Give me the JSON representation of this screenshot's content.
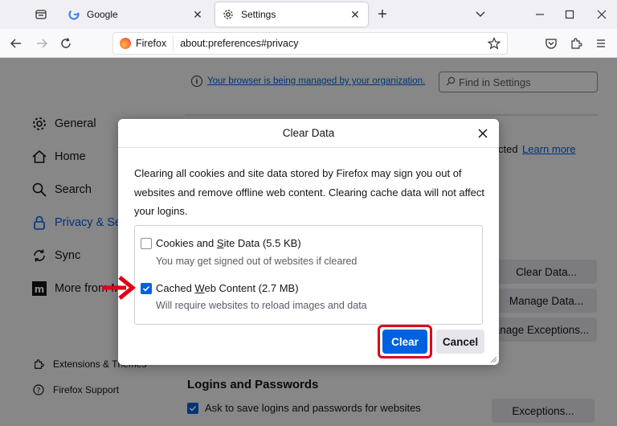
{
  "tabs": [
    {
      "title": "Google",
      "active": false,
      "icon": "google-icon"
    },
    {
      "title": "Settings",
      "active": true,
      "icon": "gear-icon"
    }
  ],
  "navbar": {
    "identity_label": "Firefox",
    "url": "about:preferences#privacy"
  },
  "page": {
    "managed_text": "Your browser is being managed by your organization.",
    "find_placeholder": "Find in Settings",
    "sidebar": [
      {
        "label": "General",
        "icon": "gear-icon"
      },
      {
        "label": "Home",
        "icon": "home-icon"
      },
      {
        "label": "Search",
        "icon": "search-icon"
      },
      {
        "label": "Privacy & Sec",
        "icon": "lock-icon",
        "active": true
      },
      {
        "label": "Sync",
        "icon": "sync-icon"
      },
      {
        "label": "More from M",
        "icon": "mozilla-icon"
      }
    ],
    "sidebar_footer": [
      {
        "label": "Extensions & Themes",
        "icon": "puzzle-icon"
      },
      {
        "label": "Firefox Support",
        "icon": "help-icon"
      }
    ],
    "cted_fragment": "cted",
    "learn_more": "Learn more",
    "clear_data_btn": "Clear Data...",
    "manage_data_btn": "Manage Data...",
    "manage_exceptions_btn": "anage Exceptions...",
    "logins_title": "Logins and Passwords",
    "ask_to_save": "Ask to save logins and passwords for websites",
    "exceptions_btn": "Exceptions..."
  },
  "dialog": {
    "title": "Clear Data",
    "description": "Clearing all cookies and site data stored by Firefox may sign you out of websites and remove offline web content. Clearing cache data will not affect your logins.",
    "option1": {
      "label_pre": "Cookies and ",
      "label_u": "S",
      "label_post": "ite Data (5.5 KB)",
      "desc": "You may get signed out of websites if cleared",
      "checked": false
    },
    "option2": {
      "label_pre": "Cached ",
      "label_u": "W",
      "label_post": "eb Content (2.7 MB)",
      "desc": "Will require websites to reload images and data",
      "checked": true
    },
    "clear_btn": "Clear",
    "cancel_btn": "Cancel"
  },
  "colors": {
    "accent": "#0061e0",
    "highlight": "#e00016"
  }
}
